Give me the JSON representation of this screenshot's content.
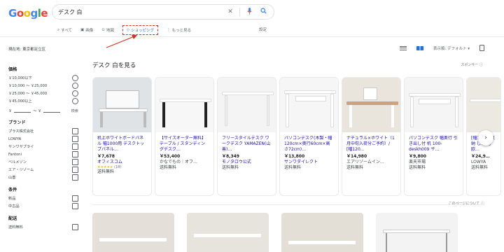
{
  "header": {
    "logo": "Google",
    "query": "デスク 白"
  },
  "tabs": [
    {
      "label": "すべて",
      "icon": "search-icon",
      "active": false
    },
    {
      "label": "画像",
      "icon": "image-icon",
      "active": false
    },
    {
      "label": "地図",
      "icon": "map-pin-icon",
      "active": false
    },
    {
      "label": "ショッピング",
      "icon": "tag-icon",
      "active": true
    },
    {
      "label": "もっと見る",
      "icon": "more-vert-icon",
      "active": false
    }
  ],
  "settings_label": "設定",
  "location_text": "現在地: 東京都足立区",
  "view": {
    "sort_label": "表示順: デフォルト"
  },
  "filters": {
    "price": {
      "title": "価格",
      "options": [
        "￥10,000以下",
        "￥10,000 ～ ￥25,000",
        "￥25,000 ～ ￥45,000",
        "￥45,000以上"
      ],
      "range_sep": "￥",
      "range_mid": "～ ￥",
      "go_label": "検索"
    },
    "brand": {
      "title": "ブランド",
      "options": [
        "プラス株式会社",
        "LOWYA",
        "サンワサプライ",
        "Fantoni",
        "ベルメゾン",
        "エア・リゾーム",
        "山善"
      ]
    },
    "condition": {
      "title": "条件",
      "options": [
        "新品",
        "中古品"
      ]
    },
    "shipping": {
      "title": "配送",
      "options": [
        "送料無料"
      ]
    }
  },
  "results": {
    "title": "デスク 白を見る",
    "sponsor_label": "スポンサー ⓘ",
    "about_label": "このページについて ⓘ",
    "cards": [
      {
        "name": "机上ホワイトボードパネル 幅1000用 デスクトップパネル…",
        "price": "￥7,678",
        "shop": "オフィスコム",
        "rating": "★★★★★",
        "reviews": "(18)",
        "shipping": "送料無料"
      },
      {
        "name": "【サイズオーダー無料】テーブル / スタンディングデスク…",
        "price": "￥53,400",
        "shop": "かなでもの｜オフ…",
        "rating": "",
        "reviews": "",
        "shipping": "送料無料"
      },
      {
        "name": "フリースタイルデスク ワークデスク YAMAZEN(山善)…",
        "price": "￥8,349",
        "shop": "モノタロウ公式",
        "rating": "",
        "reviews": "",
        "shipping": "送料無料"
      },
      {
        "name": "パソコンデスク(木製・幅120cm×奥行60cm×高さ72cm)…",
        "price": "￥13,800",
        "shop": "サンワダイレクト",
        "rating": "",
        "reviews": "",
        "shipping": "送料無料"
      },
      {
        "name": "ナチュラル×ホワイト（1月中旬入荷分ご予約）/ [幅120…",
        "price": "￥14,980",
        "shop": "エアリゾームイン…",
        "rating": "",
        "reviews": "",
        "shipping": "送料無料"
      },
      {
        "name": "パソコンデスク 幅奥行 引き出し付 机 100-deskh009 サ…",
        "price": "￥9,800",
        "shop": "楽天市場",
        "rating": "",
        "reviews": "",
        "shipping": "送料無料"
      },
      {
        "name": "[幅120 下収納 しい 北欧…",
        "price": "￥24,9…",
        "shop": "LOWYA",
        "rating": "",
        "reviews": "",
        "shipping": "送料無料"
      }
    ]
  }
}
